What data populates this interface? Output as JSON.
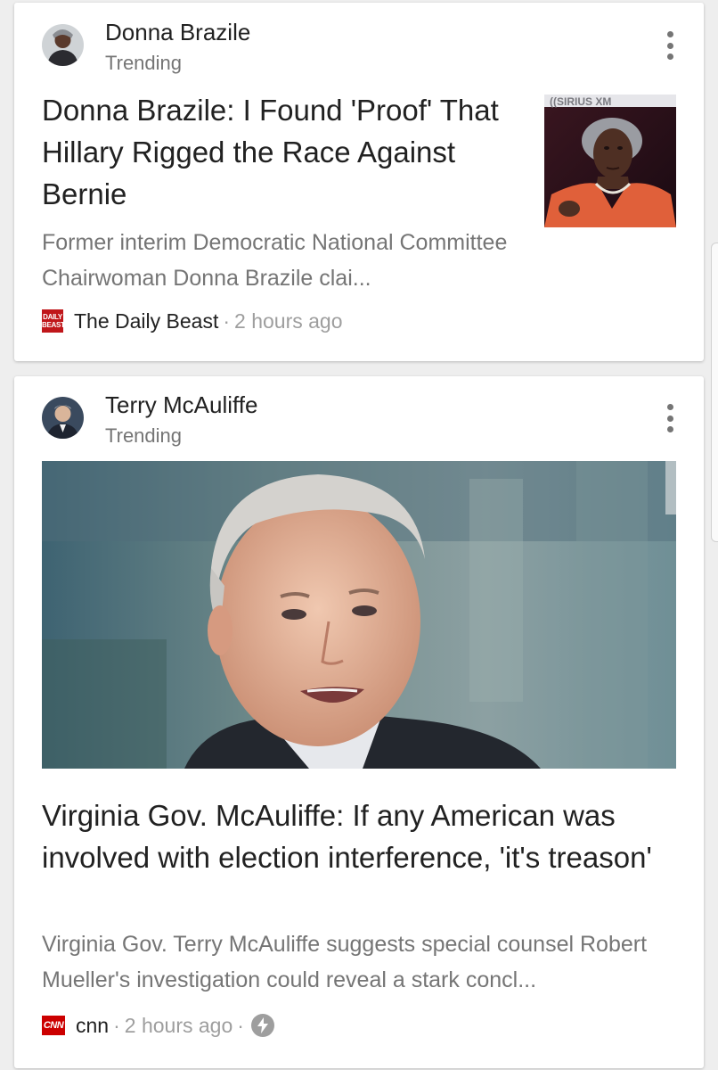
{
  "cards": [
    {
      "person": "Donna Brazile",
      "trend_label": "Trending",
      "headline": "Donna Brazile: I Found 'Proof' That Hillary Rigged the Race Against Bernie",
      "snippet": "Former interim Democratic National Committee Chairwoman Donna Brazile clai...",
      "source": "The Daily Beast",
      "logo_text": [
        "DAILY",
        "BEAST"
      ],
      "separator": "·",
      "time": "2 hours ago",
      "thumbnail_watermark": "((SIRIUS XM",
      "image": "photo of Donna Brazile speaking at a SiriusXM studio backdrop"
    },
    {
      "person": "Terry McAuliffe",
      "trend_label": "Trending",
      "headline": "Virginia Gov. McAuliffe: If any American was involved with election interference, 'it's treason'",
      "snippet": "Virginia Gov. Terry McAuliffe suggests special counsel Robert Mueller's investigation could reveal a stark concl...",
      "source": "cnn",
      "logo_text": "CNN",
      "separator": "·",
      "time": "2 hours ago",
      "amp_icon": "lightning-bolt-icon",
      "image": "close-up photo of Terry McAuliffe speaking"
    }
  ],
  "colors": {
    "background": "#eeeeee",
    "card": "#ffffff",
    "headline": "#212121",
    "secondary": "#757575",
    "daily_beast_red": "#c0161a",
    "cnn_red": "#cc0000"
  }
}
